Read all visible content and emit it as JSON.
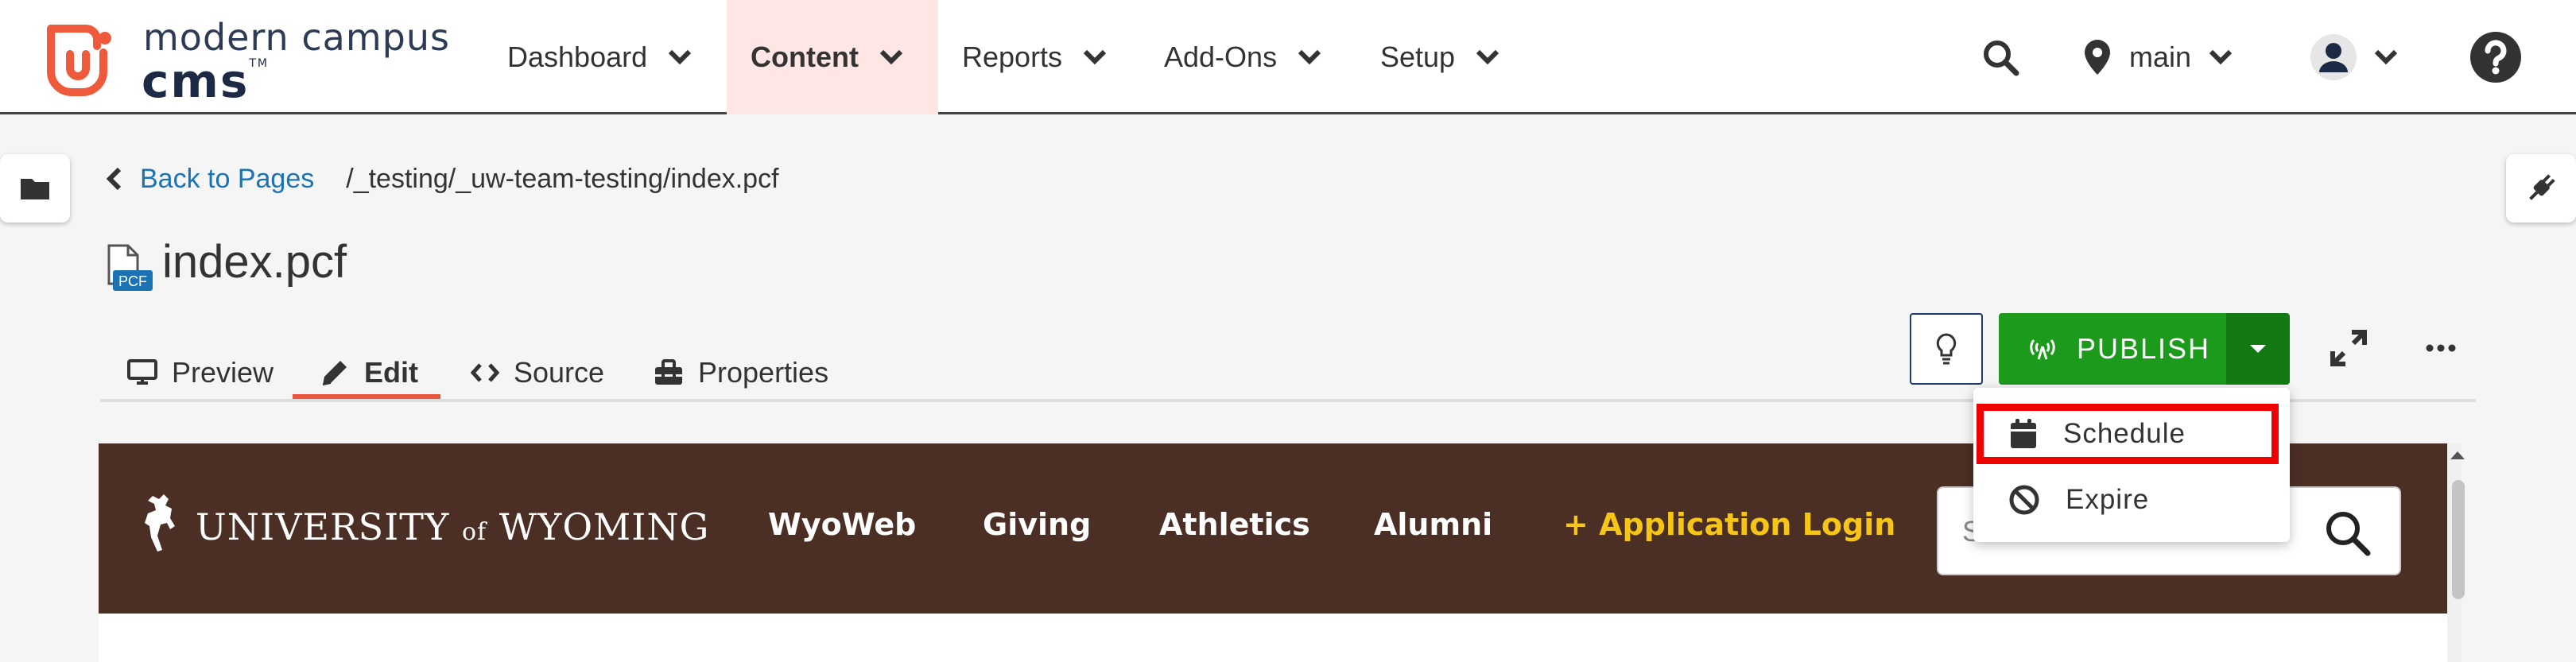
{
  "brand": {
    "line1": "modern campus",
    "line2": "cms",
    "tm": "TM"
  },
  "nav": {
    "items": [
      {
        "label": "Dashboard"
      },
      {
        "label": "Content"
      },
      {
        "label": "Reports"
      },
      {
        "label": "Add-Ons"
      },
      {
        "label": "Setup"
      }
    ],
    "site_label": "main"
  },
  "breadcrumb": {
    "back_label": "Back to Pages",
    "path": "/_testing/_uw-team-testing/index.pcf"
  },
  "page": {
    "title": "index.pcf",
    "file_badge": "PCF"
  },
  "tabs": [
    {
      "label": "Preview"
    },
    {
      "label": "Edit"
    },
    {
      "label": "Source"
    },
    {
      "label": "Properties"
    }
  ],
  "toolbar": {
    "publish_label": "PUBLISH"
  },
  "publish_menu": {
    "items": [
      {
        "label": "Schedule"
      },
      {
        "label": "Expire"
      }
    ]
  },
  "preview": {
    "site_name_parts": [
      "UNIVERSITY",
      "of",
      "WYOMING"
    ],
    "nav": [
      {
        "label": "WyoWeb"
      },
      {
        "label": "Giving"
      },
      {
        "label": "Athletics"
      },
      {
        "label": "Alumni"
      },
      {
        "label": "+ Application Login"
      }
    ],
    "search_placeholder": "Search the UW site..."
  },
  "colors": {
    "accent": "#e8563d",
    "publish_green": "#1c9a1c",
    "link_blue": "#1b73b3",
    "uw_brown": "#4b2e24",
    "uw_gold": "#f5c518"
  }
}
